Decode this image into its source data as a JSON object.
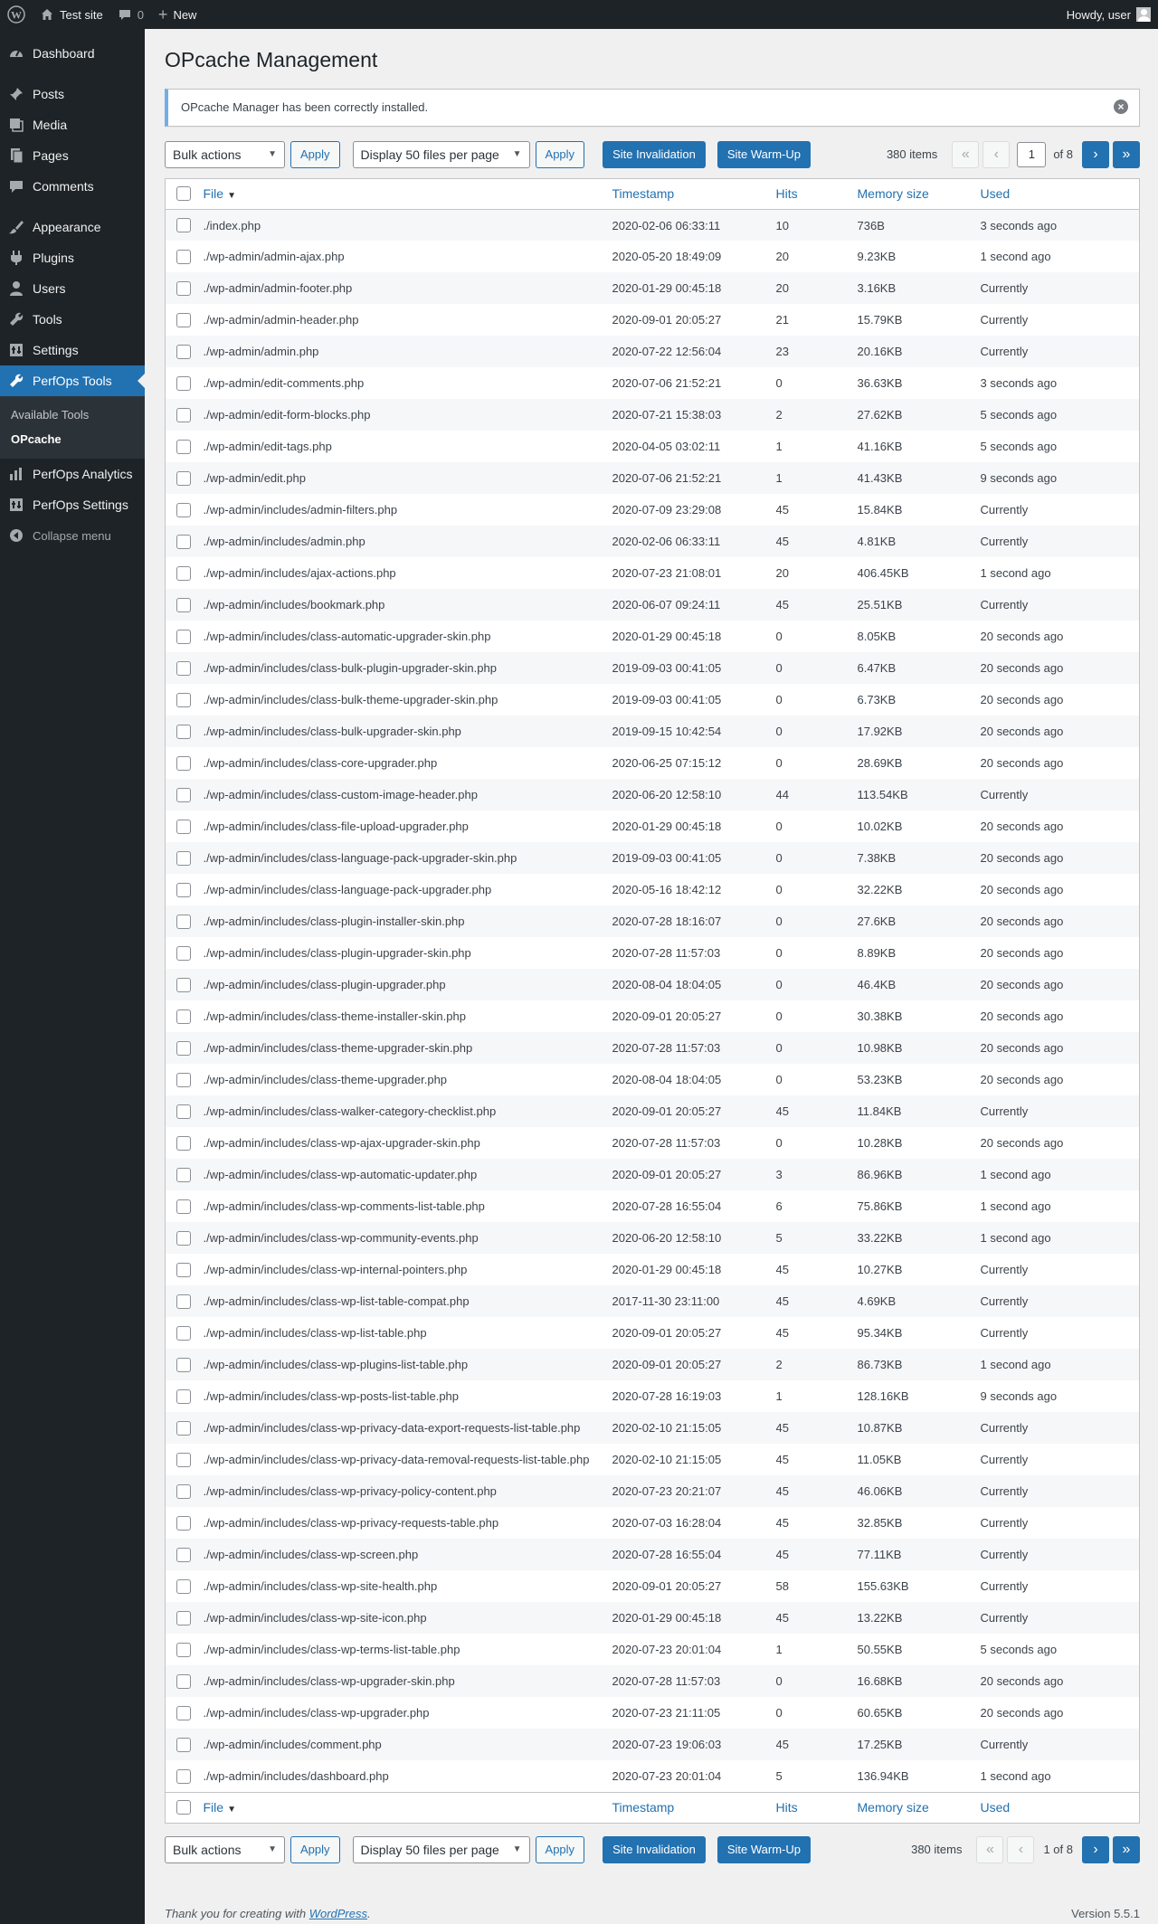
{
  "adminbar": {
    "site_name": "Test site",
    "comments_count": "0",
    "new_label": "New",
    "howdy": "Howdy, user"
  },
  "sidebar": {
    "items": [
      {
        "label": "Dashboard",
        "icon": "dashboard-icon"
      },
      {
        "label": "Posts",
        "icon": "pin-icon"
      },
      {
        "label": "Media",
        "icon": "media-icon"
      },
      {
        "label": "Pages",
        "icon": "pages-icon"
      },
      {
        "label": "Comments",
        "icon": "comments-icon"
      },
      {
        "label": "Appearance",
        "icon": "brush-icon"
      },
      {
        "label": "Plugins",
        "icon": "plugin-icon"
      },
      {
        "label": "Users",
        "icon": "users-icon"
      },
      {
        "label": "Tools",
        "icon": "wrench-icon"
      },
      {
        "label": "Settings",
        "icon": "settings-icon"
      },
      {
        "label": "PerfOps Tools",
        "icon": "wrench-icon"
      },
      {
        "label": "PerfOps Analytics",
        "icon": "chart-icon"
      },
      {
        "label": "PerfOps Settings",
        "icon": "settings-icon"
      }
    ],
    "submenu": [
      "Available Tools",
      "OPcache"
    ],
    "collapse": "Collapse menu"
  },
  "page": {
    "title": "OPcache Management",
    "notice": "OPcache Manager has been correctly installed."
  },
  "toolbar": {
    "bulk_actions": "Bulk actions",
    "apply": "Apply",
    "display": "Display 50 files per page",
    "site_invalidation": "Site Invalidation",
    "site_warmup": "Site Warm-Up",
    "items": "380 items",
    "current_page": "1",
    "of_pages": "of 8",
    "page_text": "1 of 8"
  },
  "columns": {
    "file": "File",
    "timestamp": "Timestamp",
    "hits": "Hits",
    "memory": "Memory size",
    "used": "Used"
  },
  "rows": [
    {
      "file": "./index.php",
      "timestamp": "2020-02-06 06:33:11",
      "hits": "10",
      "memory": "736B",
      "used": "3 seconds ago"
    },
    {
      "file": "./wp-admin/admin-ajax.php",
      "timestamp": "2020-05-20 18:49:09",
      "hits": "20",
      "memory": "9.23KB",
      "used": "1 second ago"
    },
    {
      "file": "./wp-admin/admin-footer.php",
      "timestamp": "2020-01-29 00:45:18",
      "hits": "20",
      "memory": "3.16KB",
      "used": "Currently"
    },
    {
      "file": "./wp-admin/admin-header.php",
      "timestamp": "2020-09-01 20:05:27",
      "hits": "21",
      "memory": "15.79KB",
      "used": "Currently"
    },
    {
      "file": "./wp-admin/admin.php",
      "timestamp": "2020-07-22 12:56:04",
      "hits": "23",
      "memory": "20.16KB",
      "used": "Currently"
    },
    {
      "file": "./wp-admin/edit-comments.php",
      "timestamp": "2020-07-06 21:52:21",
      "hits": "0",
      "memory": "36.63KB",
      "used": "3 seconds ago"
    },
    {
      "file": "./wp-admin/edit-form-blocks.php",
      "timestamp": "2020-07-21 15:38:03",
      "hits": "2",
      "memory": "27.62KB",
      "used": "5 seconds ago"
    },
    {
      "file": "./wp-admin/edit-tags.php",
      "timestamp": "2020-04-05 03:02:11",
      "hits": "1",
      "memory": "41.16KB",
      "used": "5 seconds ago"
    },
    {
      "file": "./wp-admin/edit.php",
      "timestamp": "2020-07-06 21:52:21",
      "hits": "1",
      "memory": "41.43KB",
      "used": "9 seconds ago"
    },
    {
      "file": "./wp-admin/includes/admin-filters.php",
      "timestamp": "2020-07-09 23:29:08",
      "hits": "45",
      "memory": "15.84KB",
      "used": "Currently"
    },
    {
      "file": "./wp-admin/includes/admin.php",
      "timestamp": "2020-02-06 06:33:11",
      "hits": "45",
      "memory": "4.81KB",
      "used": "Currently"
    },
    {
      "file": "./wp-admin/includes/ajax-actions.php",
      "timestamp": "2020-07-23 21:08:01",
      "hits": "20",
      "memory": "406.45KB",
      "used": "1 second ago"
    },
    {
      "file": "./wp-admin/includes/bookmark.php",
      "timestamp": "2020-06-07 09:24:11",
      "hits": "45",
      "memory": "25.51KB",
      "used": "Currently"
    },
    {
      "file": "./wp-admin/includes/class-automatic-upgrader-skin.php",
      "timestamp": "2020-01-29 00:45:18",
      "hits": "0",
      "memory": "8.05KB",
      "used": "20 seconds ago"
    },
    {
      "file": "./wp-admin/includes/class-bulk-plugin-upgrader-skin.php",
      "timestamp": "2019-09-03 00:41:05",
      "hits": "0",
      "memory": "6.47KB",
      "used": "20 seconds ago"
    },
    {
      "file": "./wp-admin/includes/class-bulk-theme-upgrader-skin.php",
      "timestamp": "2019-09-03 00:41:05",
      "hits": "0",
      "memory": "6.73KB",
      "used": "20 seconds ago"
    },
    {
      "file": "./wp-admin/includes/class-bulk-upgrader-skin.php",
      "timestamp": "2019-09-15 10:42:54",
      "hits": "0",
      "memory": "17.92KB",
      "used": "20 seconds ago"
    },
    {
      "file": "./wp-admin/includes/class-core-upgrader.php",
      "timestamp": "2020-06-25 07:15:12",
      "hits": "0",
      "memory": "28.69KB",
      "used": "20 seconds ago"
    },
    {
      "file": "./wp-admin/includes/class-custom-image-header.php",
      "timestamp": "2020-06-20 12:58:10",
      "hits": "44",
      "memory": "113.54KB",
      "used": "Currently"
    },
    {
      "file": "./wp-admin/includes/class-file-upload-upgrader.php",
      "timestamp": "2020-01-29 00:45:18",
      "hits": "0",
      "memory": "10.02KB",
      "used": "20 seconds ago"
    },
    {
      "file": "./wp-admin/includes/class-language-pack-upgrader-skin.php",
      "timestamp": "2019-09-03 00:41:05",
      "hits": "0",
      "memory": "7.38KB",
      "used": "20 seconds ago"
    },
    {
      "file": "./wp-admin/includes/class-language-pack-upgrader.php",
      "timestamp": "2020-05-16 18:42:12",
      "hits": "0",
      "memory": "32.22KB",
      "used": "20 seconds ago"
    },
    {
      "file": "./wp-admin/includes/class-plugin-installer-skin.php",
      "timestamp": "2020-07-28 18:16:07",
      "hits": "0",
      "memory": "27.6KB",
      "used": "20 seconds ago"
    },
    {
      "file": "./wp-admin/includes/class-plugin-upgrader-skin.php",
      "timestamp": "2020-07-28 11:57:03",
      "hits": "0",
      "memory": "8.89KB",
      "used": "20 seconds ago"
    },
    {
      "file": "./wp-admin/includes/class-plugin-upgrader.php",
      "timestamp": "2020-08-04 18:04:05",
      "hits": "0",
      "memory": "46.4KB",
      "used": "20 seconds ago"
    },
    {
      "file": "./wp-admin/includes/class-theme-installer-skin.php",
      "timestamp": "2020-09-01 20:05:27",
      "hits": "0",
      "memory": "30.38KB",
      "used": "20 seconds ago"
    },
    {
      "file": "./wp-admin/includes/class-theme-upgrader-skin.php",
      "timestamp": "2020-07-28 11:57:03",
      "hits": "0",
      "memory": "10.98KB",
      "used": "20 seconds ago"
    },
    {
      "file": "./wp-admin/includes/class-theme-upgrader.php",
      "timestamp": "2020-08-04 18:04:05",
      "hits": "0",
      "memory": "53.23KB",
      "used": "20 seconds ago"
    },
    {
      "file": "./wp-admin/includes/class-walker-category-checklist.php",
      "timestamp": "2020-09-01 20:05:27",
      "hits": "45",
      "memory": "11.84KB",
      "used": "Currently"
    },
    {
      "file": "./wp-admin/includes/class-wp-ajax-upgrader-skin.php",
      "timestamp": "2020-07-28 11:57:03",
      "hits": "0",
      "memory": "10.28KB",
      "used": "20 seconds ago"
    },
    {
      "file": "./wp-admin/includes/class-wp-automatic-updater.php",
      "timestamp": "2020-09-01 20:05:27",
      "hits": "3",
      "memory": "86.96KB",
      "used": "1 second ago"
    },
    {
      "file": "./wp-admin/includes/class-wp-comments-list-table.php",
      "timestamp": "2020-07-28 16:55:04",
      "hits": "6",
      "memory": "75.86KB",
      "used": "1 second ago"
    },
    {
      "file": "./wp-admin/includes/class-wp-community-events.php",
      "timestamp": "2020-06-20 12:58:10",
      "hits": "5",
      "memory": "33.22KB",
      "used": "1 second ago"
    },
    {
      "file": "./wp-admin/includes/class-wp-internal-pointers.php",
      "timestamp": "2020-01-29 00:45:18",
      "hits": "45",
      "memory": "10.27KB",
      "used": "Currently"
    },
    {
      "file": "./wp-admin/includes/class-wp-list-table-compat.php",
      "timestamp": "2017-11-30 23:11:00",
      "hits": "45",
      "memory": "4.69KB",
      "used": "Currently"
    },
    {
      "file": "./wp-admin/includes/class-wp-list-table.php",
      "timestamp": "2020-09-01 20:05:27",
      "hits": "45",
      "memory": "95.34KB",
      "used": "Currently"
    },
    {
      "file": "./wp-admin/includes/class-wp-plugins-list-table.php",
      "timestamp": "2020-09-01 20:05:27",
      "hits": "2",
      "memory": "86.73KB",
      "used": "1 second ago"
    },
    {
      "file": "./wp-admin/includes/class-wp-posts-list-table.php",
      "timestamp": "2020-07-28 16:19:03",
      "hits": "1",
      "memory": "128.16KB",
      "used": "9 seconds ago"
    },
    {
      "file": "./wp-admin/includes/class-wp-privacy-data-export-requests-list-table.php",
      "timestamp": "2020-02-10 21:15:05",
      "hits": "45",
      "memory": "10.87KB",
      "used": "Currently"
    },
    {
      "file": "./wp-admin/includes/class-wp-privacy-data-removal-requests-list-table.php",
      "timestamp": "2020-02-10 21:15:05",
      "hits": "45",
      "memory": "11.05KB",
      "used": "Currently"
    },
    {
      "file": "./wp-admin/includes/class-wp-privacy-policy-content.php",
      "timestamp": "2020-07-23 20:21:07",
      "hits": "45",
      "memory": "46.06KB",
      "used": "Currently"
    },
    {
      "file": "./wp-admin/includes/class-wp-privacy-requests-table.php",
      "timestamp": "2020-07-03 16:28:04",
      "hits": "45",
      "memory": "32.85KB",
      "used": "Currently"
    },
    {
      "file": "./wp-admin/includes/class-wp-screen.php",
      "timestamp": "2020-07-28 16:55:04",
      "hits": "45",
      "memory": "77.11KB",
      "used": "Currently"
    },
    {
      "file": "./wp-admin/includes/class-wp-site-health.php",
      "timestamp": "2020-09-01 20:05:27",
      "hits": "58",
      "memory": "155.63KB",
      "used": "Currently"
    },
    {
      "file": "./wp-admin/includes/class-wp-site-icon.php",
      "timestamp": "2020-01-29 00:45:18",
      "hits": "45",
      "memory": "13.22KB",
      "used": "Currently"
    },
    {
      "file": "./wp-admin/includes/class-wp-terms-list-table.php",
      "timestamp": "2020-07-23 20:01:04",
      "hits": "1",
      "memory": "50.55KB",
      "used": "5 seconds ago"
    },
    {
      "file": "./wp-admin/includes/class-wp-upgrader-skin.php",
      "timestamp": "2020-07-28 11:57:03",
      "hits": "0",
      "memory": "16.68KB",
      "used": "20 seconds ago"
    },
    {
      "file": "./wp-admin/includes/class-wp-upgrader.php",
      "timestamp": "2020-07-23 21:11:05",
      "hits": "0",
      "memory": "60.65KB",
      "used": "20 seconds ago"
    },
    {
      "file": "./wp-admin/includes/comment.php",
      "timestamp": "2020-07-23 19:06:03",
      "hits": "45",
      "memory": "17.25KB",
      "used": "Currently"
    },
    {
      "file": "./wp-admin/includes/dashboard.php",
      "timestamp": "2020-07-23 20:01:04",
      "hits": "5",
      "memory": "136.94KB",
      "used": "1 second ago"
    }
  ],
  "footer": {
    "thanks_prefix": "Thank you for creating with ",
    "wordpress": "WordPress",
    "thanks_suffix": ".",
    "version": "Version 5.5.1"
  },
  "colors": {
    "accent": "#2271b1",
    "sidebar_bg": "#1d2327",
    "notice_border": "#72aee6"
  }
}
